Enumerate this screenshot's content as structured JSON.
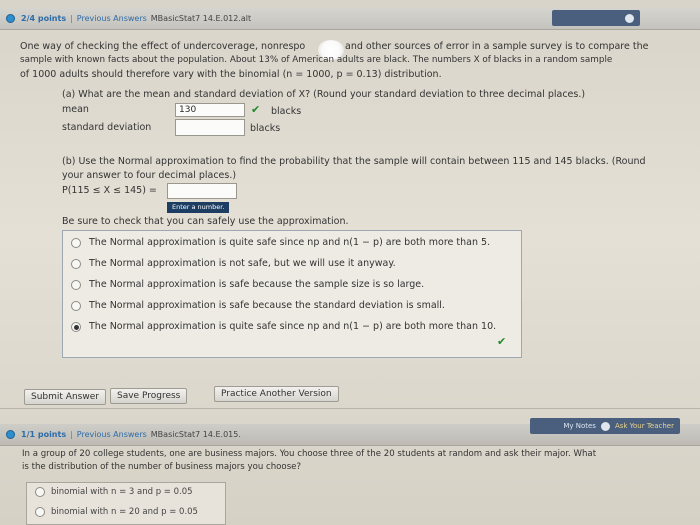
{
  "q1": {
    "points": "2/4 points",
    "prev": "Previous Answers",
    "qid": "MBasicStat7 14.E.012.alt",
    "intro_line1": "One way of checking the effect of undercoverage, nonrespo",
    "intro_line1b": "and other sources of error in a sample survey is to compare the",
    "intro_line2": "sample with known facts about the population. About 13% of American adults are black. The numbers X of blacks in a random sample",
    "intro_line3": "of 1000 adults should therefore vary with the binomial (n = 1000, p = 0.13) distribution.",
    "part_a": "(a) What are the mean and standard deviation of X? (Round your standard deviation to three decimal places.)",
    "mean_label": "mean",
    "mean_value": "130",
    "mean_unit": "blacks",
    "sd_label": "standard deviation",
    "sd_value": "",
    "sd_unit": "blacks",
    "part_b_line1": "(b) Use the Normal approximation to find the probability that the sample will contain between 115 and 145 blacks. (Round",
    "part_b_line2": "your answer to four decimal places.)",
    "prob_label": "P(115 ≤ X ≤ 145) =",
    "prob_value": "",
    "tooltip": "Enter a number.",
    "check_prompt": "Be sure to check that you can safely use the approximation.",
    "options": [
      "The Normal approximation is quite safe since np and n(1 − p) are both more than 5.",
      "The Normal approximation is not safe, but we will use it anyway.",
      "The Normal approximation is safe because the sample size is so large.",
      "The Normal approximation is safe because the standard deviation is small.",
      "The Normal approximation is quite safe since np and n(1 − p) are both more than 10."
    ],
    "selected_index": 4,
    "submit": "Submit Answer",
    "save": "Save Progress",
    "practice": "Practice Another Version"
  },
  "q2": {
    "points": "1/1 points",
    "prev": "Previous Answers",
    "qid": "MBasicStat7 14.E.015.",
    "my_notes": "My Notes",
    "ask": "Ask Your Teacher",
    "text_line1": "In a group of 20 college students, one are business majors. You choose three of the 20 students at random and ask their major. What",
    "text_line2": "is the distribution of the number of business majors you choose?",
    "options": [
      "binomial with n = 3 and p = 0.05",
      "binomial with n = 20 and p = 0.05"
    ]
  },
  "colors": {
    "accent": "#2d6ca8",
    "check": "#1f8a2a",
    "tooltip": "#1d3d63"
  }
}
